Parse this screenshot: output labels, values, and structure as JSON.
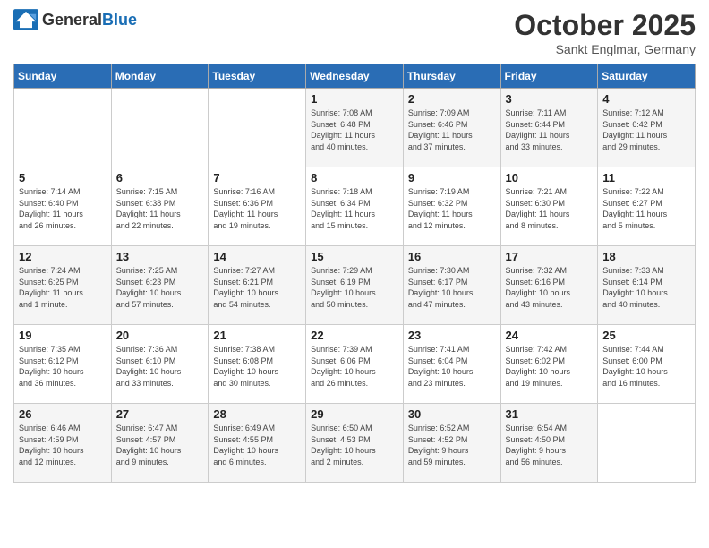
{
  "header": {
    "logo_general": "General",
    "logo_blue": "Blue",
    "month": "October 2025",
    "location": "Sankt Englmar, Germany"
  },
  "weekdays": [
    "Sunday",
    "Monday",
    "Tuesday",
    "Wednesday",
    "Thursday",
    "Friday",
    "Saturday"
  ],
  "weeks": [
    [
      {
        "day": "",
        "info": ""
      },
      {
        "day": "",
        "info": ""
      },
      {
        "day": "",
        "info": ""
      },
      {
        "day": "1",
        "info": "Sunrise: 7:08 AM\nSunset: 6:48 PM\nDaylight: 11 hours\nand 40 minutes."
      },
      {
        "day": "2",
        "info": "Sunrise: 7:09 AM\nSunset: 6:46 PM\nDaylight: 11 hours\nand 37 minutes."
      },
      {
        "day": "3",
        "info": "Sunrise: 7:11 AM\nSunset: 6:44 PM\nDaylight: 11 hours\nand 33 minutes."
      },
      {
        "day": "4",
        "info": "Sunrise: 7:12 AM\nSunset: 6:42 PM\nDaylight: 11 hours\nand 29 minutes."
      }
    ],
    [
      {
        "day": "5",
        "info": "Sunrise: 7:14 AM\nSunset: 6:40 PM\nDaylight: 11 hours\nand 26 minutes."
      },
      {
        "day": "6",
        "info": "Sunrise: 7:15 AM\nSunset: 6:38 PM\nDaylight: 11 hours\nand 22 minutes."
      },
      {
        "day": "7",
        "info": "Sunrise: 7:16 AM\nSunset: 6:36 PM\nDaylight: 11 hours\nand 19 minutes."
      },
      {
        "day": "8",
        "info": "Sunrise: 7:18 AM\nSunset: 6:34 PM\nDaylight: 11 hours\nand 15 minutes."
      },
      {
        "day": "9",
        "info": "Sunrise: 7:19 AM\nSunset: 6:32 PM\nDaylight: 11 hours\nand 12 minutes."
      },
      {
        "day": "10",
        "info": "Sunrise: 7:21 AM\nSunset: 6:30 PM\nDaylight: 11 hours\nand 8 minutes."
      },
      {
        "day": "11",
        "info": "Sunrise: 7:22 AM\nSunset: 6:27 PM\nDaylight: 11 hours\nand 5 minutes."
      }
    ],
    [
      {
        "day": "12",
        "info": "Sunrise: 7:24 AM\nSunset: 6:25 PM\nDaylight: 11 hours\nand 1 minute."
      },
      {
        "day": "13",
        "info": "Sunrise: 7:25 AM\nSunset: 6:23 PM\nDaylight: 10 hours\nand 57 minutes."
      },
      {
        "day": "14",
        "info": "Sunrise: 7:27 AM\nSunset: 6:21 PM\nDaylight: 10 hours\nand 54 minutes."
      },
      {
        "day": "15",
        "info": "Sunrise: 7:29 AM\nSunset: 6:19 PM\nDaylight: 10 hours\nand 50 minutes."
      },
      {
        "day": "16",
        "info": "Sunrise: 7:30 AM\nSunset: 6:17 PM\nDaylight: 10 hours\nand 47 minutes."
      },
      {
        "day": "17",
        "info": "Sunrise: 7:32 AM\nSunset: 6:16 PM\nDaylight: 10 hours\nand 43 minutes."
      },
      {
        "day": "18",
        "info": "Sunrise: 7:33 AM\nSunset: 6:14 PM\nDaylight: 10 hours\nand 40 minutes."
      }
    ],
    [
      {
        "day": "19",
        "info": "Sunrise: 7:35 AM\nSunset: 6:12 PM\nDaylight: 10 hours\nand 36 minutes."
      },
      {
        "day": "20",
        "info": "Sunrise: 7:36 AM\nSunset: 6:10 PM\nDaylight: 10 hours\nand 33 minutes."
      },
      {
        "day": "21",
        "info": "Sunrise: 7:38 AM\nSunset: 6:08 PM\nDaylight: 10 hours\nand 30 minutes."
      },
      {
        "day": "22",
        "info": "Sunrise: 7:39 AM\nSunset: 6:06 PM\nDaylight: 10 hours\nand 26 minutes."
      },
      {
        "day": "23",
        "info": "Sunrise: 7:41 AM\nSunset: 6:04 PM\nDaylight: 10 hours\nand 23 minutes."
      },
      {
        "day": "24",
        "info": "Sunrise: 7:42 AM\nSunset: 6:02 PM\nDaylight: 10 hours\nand 19 minutes."
      },
      {
        "day": "25",
        "info": "Sunrise: 7:44 AM\nSunset: 6:00 PM\nDaylight: 10 hours\nand 16 minutes."
      }
    ],
    [
      {
        "day": "26",
        "info": "Sunrise: 6:46 AM\nSunset: 4:59 PM\nDaylight: 10 hours\nand 12 minutes."
      },
      {
        "day": "27",
        "info": "Sunrise: 6:47 AM\nSunset: 4:57 PM\nDaylight: 10 hours\nand 9 minutes."
      },
      {
        "day": "28",
        "info": "Sunrise: 6:49 AM\nSunset: 4:55 PM\nDaylight: 10 hours\nand 6 minutes."
      },
      {
        "day": "29",
        "info": "Sunrise: 6:50 AM\nSunset: 4:53 PM\nDaylight: 10 hours\nand 2 minutes."
      },
      {
        "day": "30",
        "info": "Sunrise: 6:52 AM\nSunset: 4:52 PM\nDaylight: 9 hours\nand 59 minutes."
      },
      {
        "day": "31",
        "info": "Sunrise: 6:54 AM\nSunset: 4:50 PM\nDaylight: 9 hours\nand 56 minutes."
      },
      {
        "day": "",
        "info": ""
      }
    ]
  ]
}
